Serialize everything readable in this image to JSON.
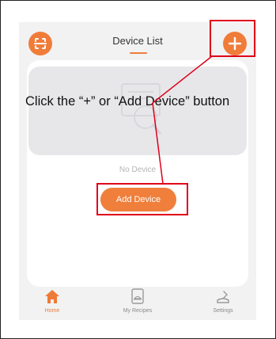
{
  "header": {
    "title": "Device List",
    "scan_icon": "scan-icon",
    "add_icon": "plus-icon"
  },
  "empty_state": {
    "label": "No Device",
    "illustration_icon": "device-search-icon"
  },
  "add_device_button": {
    "label": "Add Device"
  },
  "tabbar": {
    "tabs": [
      {
        "label": "Home",
        "icon": "house-icon",
        "active": true
      },
      {
        "label": "My Recipes",
        "icon": "recipe-book-icon",
        "active": false
      },
      {
        "label": "Settings",
        "icon": "settings-icon",
        "active": false
      }
    ]
  },
  "annotation": {
    "text": "Click the “+” or “Add Device” button"
  },
  "colors": {
    "accent": "#f07c3a",
    "highlight": "#e0001a",
    "tab_active": "#ee7a37",
    "tab_inactive": "#8a8a8a"
  }
}
